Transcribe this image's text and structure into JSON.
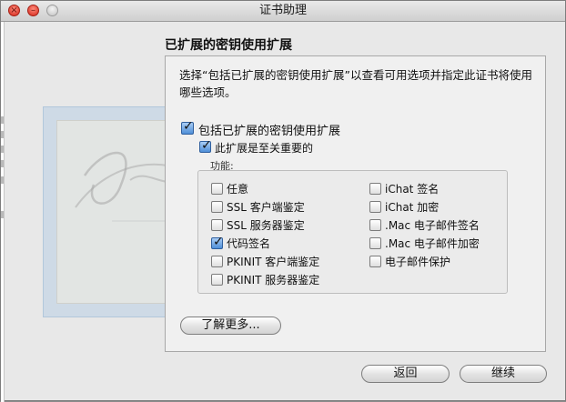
{
  "window": {
    "title": "证书助理"
  },
  "section": {
    "title": "已扩展的密钥使用扩展",
    "description": "选择“包括已扩展的密钥使用扩展”以查看可用选项并指定此证书将使用哪些选项。"
  },
  "options": {
    "include": {
      "label": "包括已扩展的密钥使用扩展",
      "checked": true
    },
    "critical": {
      "label": "此扩展是至关重要的",
      "checked": true
    }
  },
  "capabilities": {
    "label": "功能:",
    "left": [
      {
        "label": "任意",
        "checked": false
      },
      {
        "label": "SSL 客户端鉴定",
        "checked": false
      },
      {
        "label": "SSL 服务器鉴定",
        "checked": false
      },
      {
        "label": "代码签名",
        "checked": true
      },
      {
        "label": "PKINIT 客户端鉴定",
        "checked": false
      },
      {
        "label": "PKINIT 服务器鉴定",
        "checked": false
      }
    ],
    "right": [
      {
        "label": "iChat 签名",
        "checked": false
      },
      {
        "label": "iChat 加密",
        "checked": false
      },
      {
        "label": ".Mac 电子邮件签名",
        "checked": false
      },
      {
        "label": ".Mac 电子邮件加密",
        "checked": false
      },
      {
        "label": "电子邮件保护",
        "checked": false
      }
    ]
  },
  "buttons": {
    "learn_more": "了解更多...",
    "back": "返回",
    "continue": "继续"
  },
  "icons": {
    "close": "close-icon",
    "minimize": "minimize-icon",
    "zoom": "zoom-icon",
    "certificate": "certificate-icon",
    "check": "checkmark-icon"
  },
  "colors": {
    "close": "#d3261a",
    "checkbox_on": "#4f8fd8",
    "window_bg": "#e8e8e8"
  }
}
